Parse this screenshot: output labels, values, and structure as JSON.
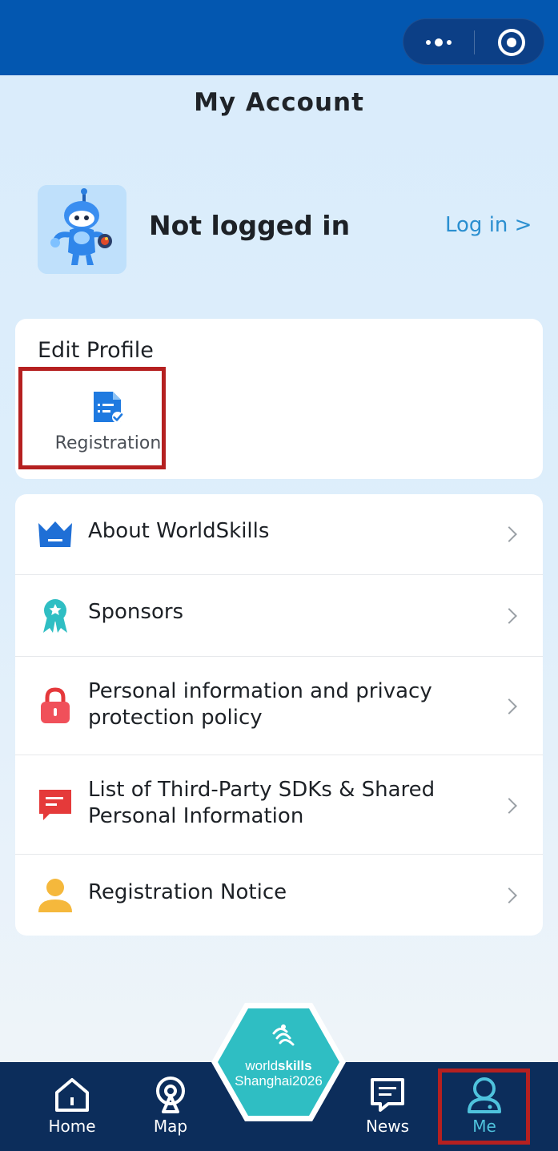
{
  "header": {
    "title": "My Account",
    "capsule_icons": [
      "more-dots-icon",
      "target-close-icon"
    ]
  },
  "profile": {
    "status": "Not logged in",
    "login_link": "Log in >",
    "avatar_icon": "mascot-avatar"
  },
  "edit_profile": {
    "title": "Edit Profile",
    "items": [
      {
        "label": "Registration",
        "icon": "registration-form-icon"
      }
    ]
  },
  "menu": {
    "items": [
      {
        "label": "About WorldSkills",
        "icon": "crown-icon"
      },
      {
        "label": "Sponsors",
        "icon": "award-ribbon-icon"
      },
      {
        "label": "Personal information and privacy protection policy",
        "icon": "lock-icon"
      },
      {
        "label": "List of Third-Party SDKs & Shared Personal Information",
        "icon": "message-icon"
      },
      {
        "label": "Registration Notice",
        "icon": "person-icon"
      }
    ]
  },
  "tabbar": {
    "tabs": [
      {
        "label": "Home",
        "icon": "home-icon"
      },
      {
        "label": "Map",
        "icon": "map-pin-icon"
      },
      {
        "label": "News",
        "icon": "news-icon"
      },
      {
        "label": "Me",
        "icon": "user-icon"
      }
    ],
    "center_logo": {
      "line1_a": "world",
      "line1_b": "skills",
      "line2": "Shanghai2026"
    },
    "active": "Me"
  },
  "colors": {
    "header_blue": "#0357b0",
    "tabbar_navy": "#0c2d5b",
    "accent_teal": "#2fbec3",
    "link_blue": "#2a8fd0",
    "highlight_red": "#b52020"
  }
}
